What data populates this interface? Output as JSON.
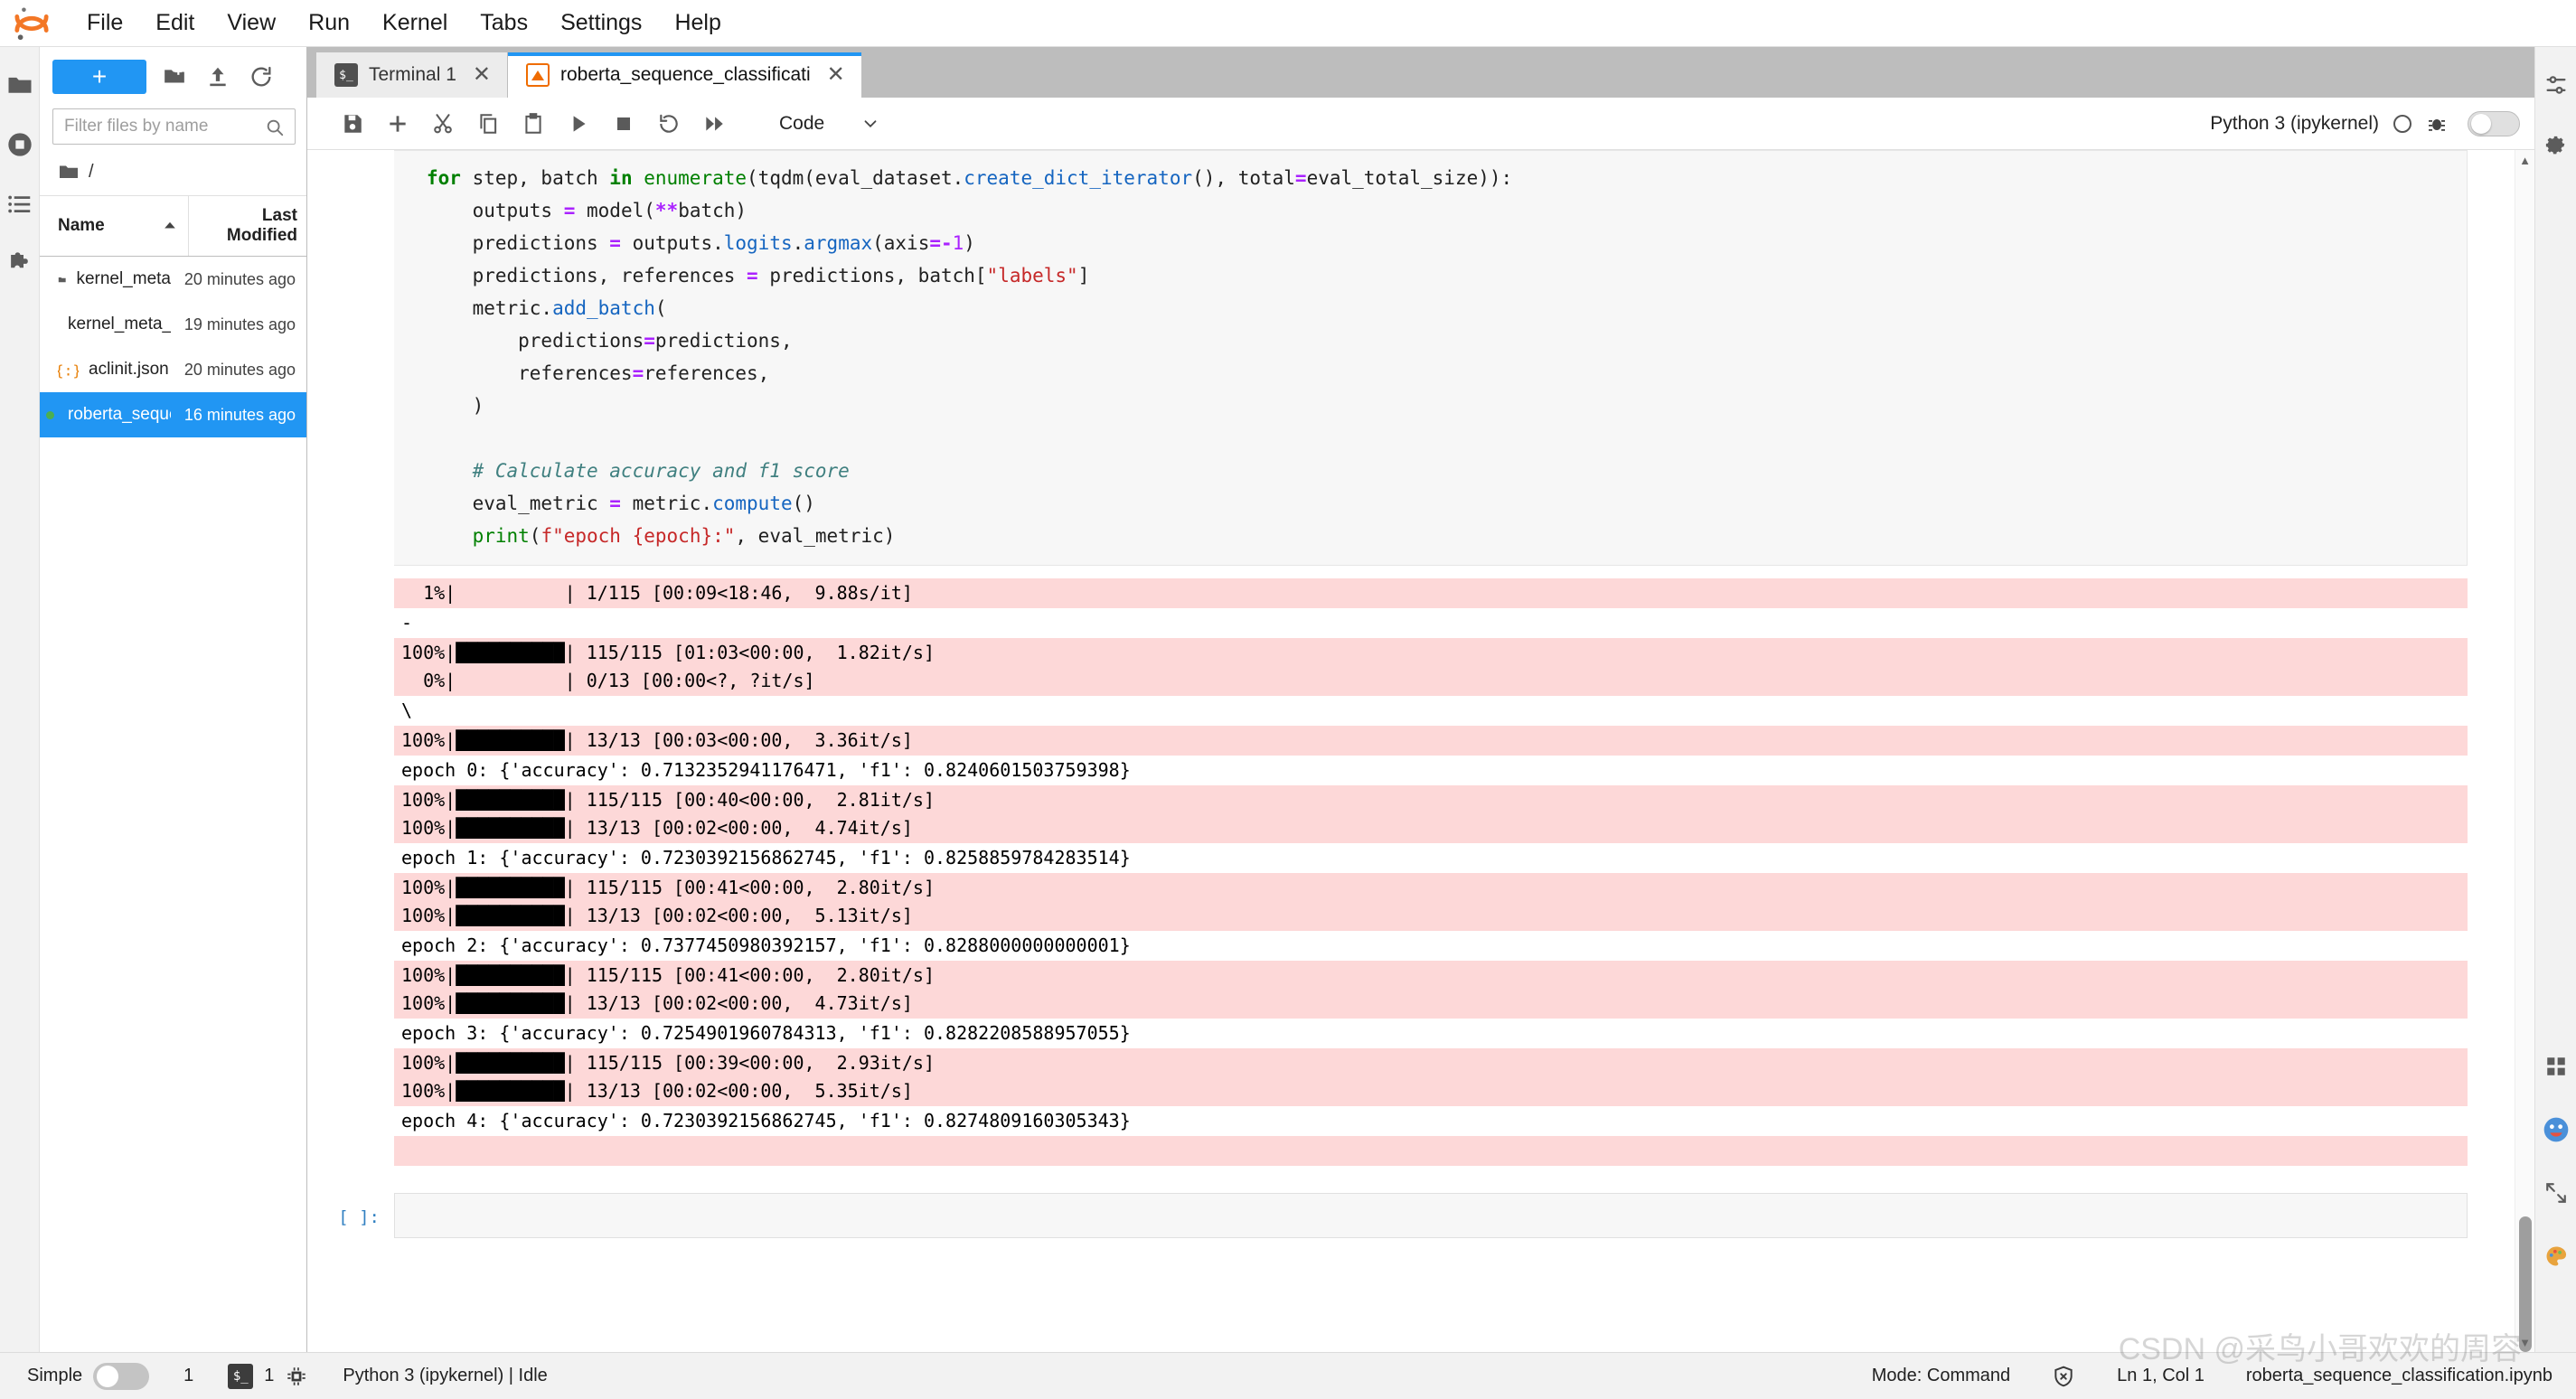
{
  "app": {
    "logo_icon": "jupyter-logo",
    "menu": [
      "File",
      "Edit",
      "View",
      "Run",
      "Kernel",
      "Tabs",
      "Settings",
      "Help"
    ]
  },
  "activitybar": {
    "items": [
      {
        "icon": "folder-icon",
        "name": "file-browser",
        "active": true
      },
      {
        "icon": "running-sessions-icon",
        "name": "running-terminals-kernels",
        "active": false
      },
      {
        "icon": "toc-icon",
        "name": "table-of-contents",
        "active": false
      },
      {
        "icon": "extension-puzzle-icon",
        "name": "extension-manager",
        "active": false
      }
    ]
  },
  "filebrowser": {
    "new_launcher_label": "+",
    "new_folder_icon": "new-folder-icon",
    "upload_icon": "upload-icon",
    "refresh_icon": "refresh-icon",
    "filter_placeholder": "Filter files by name",
    "filter_value": "",
    "search_icon": "search-icon",
    "breadcrumb_root": "/",
    "columns": [
      "Name",
      "Last Modified"
    ],
    "sort_icon": "sort-ascending-icon",
    "rows": [
      {
        "name": "kernel_meta",
        "modified": "20 minutes ago",
        "icon": "folder-icon",
        "selected": false,
        "running": false
      },
      {
        "name": "kernel_meta_t...",
        "modified": "19 minutes ago",
        "icon": "folder-icon",
        "selected": false,
        "running": false
      },
      {
        "name": "aclinit.json",
        "modified": "20 minutes ago",
        "icon": "json-icon",
        "selected": false,
        "running": false
      },
      {
        "name": "roberta_seque...",
        "modified": "16 minutes ago",
        "icon": "notebook-icon",
        "selected": true,
        "running": true
      }
    ]
  },
  "tabs": {
    "scroll_left_icon": "chevron-left-icon",
    "items": [
      {
        "label": "Terminal 1",
        "icon": "terminal-icon",
        "active": false,
        "close_icon": "close-icon"
      },
      {
        "label": "roberta_sequence_classificati",
        "icon": "notebook-icon",
        "active": true,
        "close_icon": "close-icon"
      }
    ]
  },
  "notebook_toolbar": {
    "buttons": [
      {
        "name": "save-button",
        "icon": "save-icon"
      },
      {
        "name": "insert-cell-button",
        "icon": "plus-icon"
      },
      {
        "name": "cut-cell-button",
        "icon": "scissors-icon"
      },
      {
        "name": "copy-cell-button",
        "icon": "copy-icon"
      },
      {
        "name": "paste-cell-button",
        "icon": "paste-icon"
      },
      {
        "name": "run-cell-button",
        "icon": "play-icon"
      },
      {
        "name": "interrupt-kernel-button",
        "icon": "stop-icon"
      },
      {
        "name": "restart-kernel-button",
        "icon": "restart-icon"
      },
      {
        "name": "restart-and-run-all-button",
        "icon": "fast-forward-icon"
      }
    ],
    "cell_type": "Code",
    "cell_type_caret": "chevron-down-icon",
    "kernel_name": "Python 3 (ipykernel)",
    "kernel_busy_icon": "kernel-idle-circle-icon",
    "kernel_settings_icon": "kernel-bug-icon",
    "debugger_toggle": "off"
  },
  "cell": {
    "prompt": "",
    "code_lines": [
      [
        {
          "t": "for ",
          "c": "kw"
        },
        {
          "t": "step, batch "
        },
        {
          "t": "in ",
          "c": "kw"
        },
        {
          "t": "enumerate",
          "c": "bi"
        },
        {
          "t": "(tqdm(eval_dataset."
        },
        {
          "t": "create_dict_iterator",
          "c": "fn"
        },
        {
          "t": "(), total"
        },
        {
          "t": "=",
          "c": "op"
        },
        {
          "t": "eval_total_size)):"
        }
      ],
      [
        {
          "t": "    outputs "
        },
        {
          "t": "=",
          "c": "op"
        },
        {
          "t": " model("
        },
        {
          "t": "**",
          "c": "op"
        },
        {
          "t": "batch)"
        }
      ],
      [
        {
          "t": "    predictions "
        },
        {
          "t": "=",
          "c": "op"
        },
        {
          "t": " outputs."
        },
        {
          "t": "logits",
          "c": "fn"
        },
        {
          "t": "."
        },
        {
          "t": "argmax",
          "c": "fn"
        },
        {
          "t": "(axis"
        },
        {
          "t": "=-",
          "c": "op"
        },
        {
          "t": "1",
          "c": "num"
        },
        {
          "t": ")"
        }
      ],
      [
        {
          "t": "    predictions, references "
        },
        {
          "t": "=",
          "c": "op"
        },
        {
          "t": " predictions, batch["
        },
        {
          "t": "\"labels\"",
          "c": "str"
        },
        {
          "t": "]"
        }
      ],
      [
        {
          "t": "    metric."
        },
        {
          "t": "add_batch",
          "c": "fn"
        },
        {
          "t": "("
        }
      ],
      [
        {
          "t": "        predictions"
        },
        {
          "t": "=",
          "c": "op"
        },
        {
          "t": "predictions,"
        }
      ],
      [
        {
          "t": "        references"
        },
        {
          "t": "=",
          "c": "op"
        },
        {
          "t": "references,"
        }
      ],
      [
        {
          "t": "    )"
        }
      ],
      [
        {
          "t": ""
        }
      ],
      [
        {
          "t": "    # Calculate accuracy and f1 score",
          "c": "cm"
        }
      ],
      [
        {
          "t": "    eval_metric "
        },
        {
          "t": "=",
          "c": "op"
        },
        {
          "t": " metric."
        },
        {
          "t": "compute",
          "c": "fn"
        },
        {
          "t": "()"
        }
      ],
      [
        {
          "t": "    print",
          "c": "bi"
        },
        {
          "t": "("
        },
        {
          "t": "f\"epoch {epoch}:\"",
          "c": "str"
        },
        {
          "t": ", eval_metric)"
        }
      ]
    ],
    "outputs": [
      {
        "style": "err",
        "text": "  1%|          | 1/115 [00:09<18:46,  9.88s/it]"
      },
      {
        "style": "plain",
        "text": "-"
      },
      {
        "style": "err",
        "text": "100%|██████████| 115/115 [01:03<00:00,  1.82it/s]\n  0%|          | 0/13 [00:00<?, ?it/s]"
      },
      {
        "style": "plain",
        "text": "\\"
      },
      {
        "style": "err",
        "text": "100%|██████████| 13/13 [00:03<00:00,  3.36it/s]"
      },
      {
        "style": "plain",
        "text": "epoch 0: {'accuracy': 0.7132352941176471, 'f1': 0.8240601503759398}"
      },
      {
        "style": "err",
        "text": "100%|██████████| 115/115 [00:40<00:00,  2.81it/s]\n100%|██████████| 13/13 [00:02<00:00,  4.74it/s]"
      },
      {
        "style": "plain",
        "text": "epoch 1: {'accuracy': 0.7230392156862745, 'f1': 0.8258859784283514}"
      },
      {
        "style": "err",
        "text": "100%|██████████| 115/115 [00:41<00:00,  2.80it/s]\n100%|██████████| 13/13 [00:02<00:00,  5.13it/s]"
      },
      {
        "style": "plain",
        "text": "epoch 2: {'accuracy': 0.7377450980392157, 'f1': 0.8288000000000001}"
      },
      {
        "style": "err",
        "text": "100%|██████████| 115/115 [00:41<00:00,  2.80it/s]\n100%|██████████| 13/13 [00:02<00:00,  4.73it/s]"
      },
      {
        "style": "plain",
        "text": "epoch 3: {'accuracy': 0.7254901960784313, 'f1': 0.8282208588957055}"
      },
      {
        "style": "err",
        "text": "100%|██████████| 115/115 [00:39<00:00,  2.93it/s]\n100%|██████████| 13/13 [00:02<00:00,  5.35it/s]"
      },
      {
        "style": "plain",
        "text": "epoch 4: {'accuracy': 0.7230392156862745, 'f1': 0.8274809160305343}"
      },
      {
        "style": "err",
        "text": " "
      }
    ],
    "empty_prompt": "[ ]:"
  },
  "rightbar": {
    "items": [
      {
        "icon": "settings-sliders-icon",
        "name": "property-inspector"
      },
      {
        "icon": "gear-icon",
        "name": "settings-panel"
      }
    ],
    "bottom_items": [
      {
        "icon": "grid-apps-icon",
        "name": "apps-grid"
      },
      {
        "icon": "smiley-face-icon",
        "name": "feedback-smiley"
      },
      {
        "icon": "expand-arrows-icon",
        "name": "expand-toggle"
      },
      {
        "icon": "palette-icon",
        "name": "theme-palette"
      }
    ]
  },
  "statusbar": {
    "simple_label": "Simple",
    "simple_toggle": "off",
    "kernel_count": "1",
    "terminal_icon": "terminal-icon",
    "terminal_count": "1",
    "cpu_icon": "kernel-chip-icon",
    "kernel_text": "Python 3 (ipykernel) | Idle",
    "mode_text": "Mode: Command",
    "shield_icon": "shield-x-icon",
    "position_text": "Ln 1, Col 1",
    "filename": "roberta_sequence_classification.ipynb"
  },
  "watermark": "CSDN @采鸟小哥欢欢的周容"
}
